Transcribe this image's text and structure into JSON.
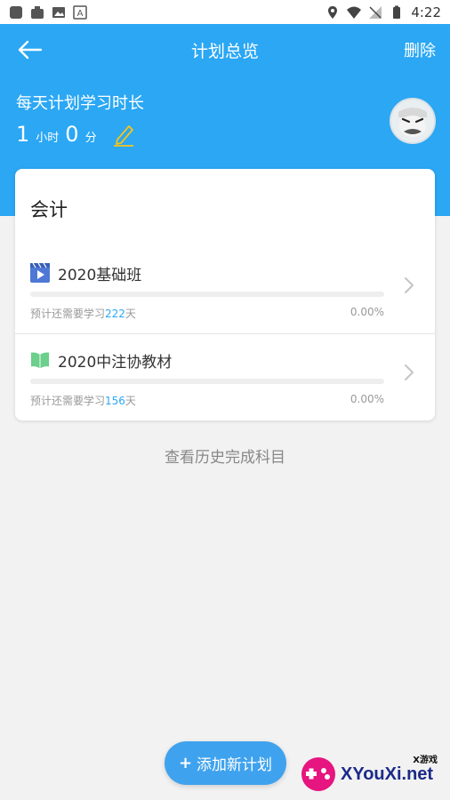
{
  "statusbar": {
    "time": "4:22"
  },
  "header": {
    "title": "计划总览",
    "delete_label": "删除"
  },
  "daily_plan": {
    "label": "每天计划学习时长",
    "hours": "1",
    "hours_unit": "小时",
    "minutes": "0",
    "minutes_unit": "分"
  },
  "subject": {
    "title": "会计",
    "courses": [
      {
        "name": "2020基础班",
        "icon": "video-icon",
        "meta_prefix": "预计还需要学习",
        "days": "222",
        "meta_suffix": "天",
        "percent_label": "0.00%",
        "progress": 0
      },
      {
        "name": "2020中注协教材",
        "icon": "book-icon",
        "meta_prefix": "预计还需要学习",
        "days": "156",
        "meta_suffix": "天",
        "percent_label": "0.00%",
        "progress": 0
      }
    ]
  },
  "history_link": "查看历史完成科目",
  "add_button": {
    "plus": "+",
    "label": "添加新计划"
  },
  "watermark": {
    "tag": "X游戏",
    "text": "XYouXi.net"
  },
  "colors": {
    "primary": "#2ba7f4",
    "button": "#3fa2ee",
    "video_icon": "#4f77d6",
    "book_icon": "#6ccf8c"
  }
}
